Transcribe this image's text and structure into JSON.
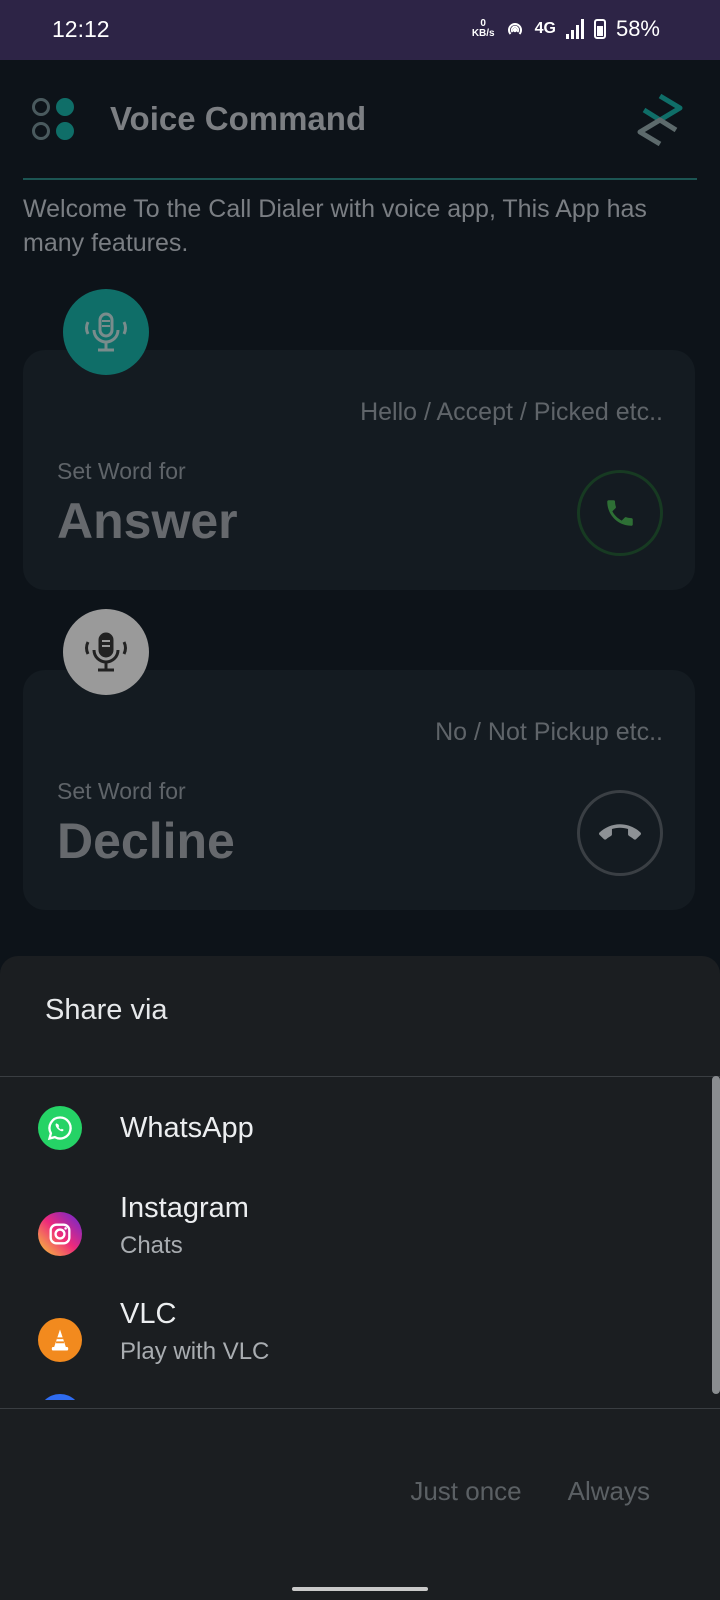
{
  "status_bar": {
    "time": "12:12",
    "net_speed_value": "0",
    "net_speed_unit": "KB/s",
    "network_type": "4G",
    "battery": "58%"
  },
  "app_bar": {
    "title": "Voice Command",
    "menu_icon": "grid-dots-icon",
    "logo_icon": "app-logo-icon"
  },
  "welcome_text": "Welcome To the Call Dialer with voice app, This App has many features.",
  "cards": [
    {
      "hint": "Hello / Accept / Picked etc..",
      "set_label": "Set Word for",
      "word": "Answer",
      "mic_icon": "microphone-icon",
      "action_icon": "phone-answer-icon",
      "accent": "#0f6e68"
    },
    {
      "hint": "No / Not Pickup etc..",
      "set_label": "Set Word for",
      "word": "Decline",
      "mic_icon": "microphone-icon",
      "action_icon": "phone-decline-icon",
      "accent": "#9a9a9a"
    }
  ],
  "share_sheet": {
    "title": "Share via",
    "items": [
      {
        "name": "WhatsApp",
        "subtitle": "",
        "icon": "whatsapp-icon"
      },
      {
        "name": "Instagram",
        "subtitle": "Chats",
        "icon": "instagram-icon"
      },
      {
        "name": "VLC",
        "subtitle": "Play with VLC",
        "icon": "vlc-icon"
      }
    ],
    "just_once_label": "Just once",
    "always_label": "Always"
  },
  "colors": {
    "status_bar": "#2d2446",
    "background": "#0d1319",
    "accent_teal": "#0f6e68",
    "sheet": "#1b1e21",
    "answer_green": "#2e7d32"
  }
}
